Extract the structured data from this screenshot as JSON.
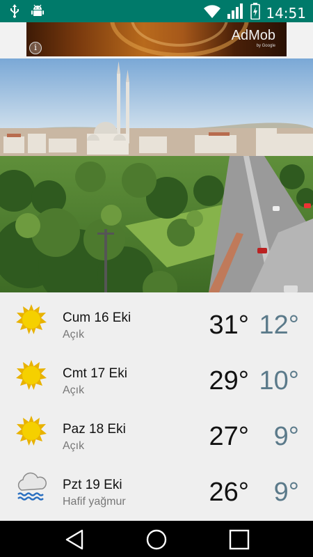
{
  "status_bar": {
    "time": "14:51",
    "left_icons": [
      "usb-icon",
      "android-debug-icon"
    ],
    "right_icons": [
      "wifi-icon",
      "cell-signal-icon",
      "battery-charging-icon"
    ]
  },
  "ad": {
    "brand": "AdMob",
    "sub": "by Google",
    "info_glyph": "i"
  },
  "city_image": {
    "icon": "city-mosque-photo"
  },
  "forecast": {
    "days": [
      {
        "date": "Cum 16 Eki",
        "condition": "Açık",
        "high": "31°",
        "low": "12°",
        "icon": "sun-icon"
      },
      {
        "date": "Cmt 17 Eki",
        "condition": "Açık",
        "high": "29°",
        "low": "10°",
        "icon": "sun-icon"
      },
      {
        "date": "Paz 18 Eki",
        "condition": "Açık",
        "high": "27°",
        "low": "9°",
        "icon": "sun-icon"
      },
      {
        "date": "Pzt 19 Eki",
        "condition": "Hafif yağmur",
        "high": "26°",
        "low": "9°",
        "icon": "cloud-rain-icon"
      }
    ]
  },
  "colors": {
    "status_bar": "#007a6a",
    "high_temp": "#111111",
    "low_temp": "#5b7a8a",
    "sun": "#f5d000"
  },
  "nav": {
    "buttons": [
      "back-icon",
      "home-icon",
      "recents-icon"
    ]
  }
}
